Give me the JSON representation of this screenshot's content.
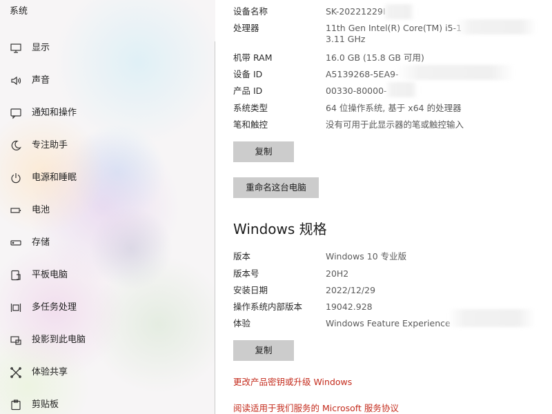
{
  "sidebar": {
    "title": "系统",
    "items": [
      {
        "label": "显示",
        "icon": "monitor-icon"
      },
      {
        "label": "声音",
        "icon": "speaker-icon"
      },
      {
        "label": "通知和操作",
        "icon": "notification-icon"
      },
      {
        "label": "专注助手",
        "icon": "moon-icon"
      },
      {
        "label": "电源和睡眠",
        "icon": "power-icon"
      },
      {
        "label": "电池",
        "icon": "battery-icon"
      },
      {
        "label": "存储",
        "icon": "storage-icon"
      },
      {
        "label": "平板电脑",
        "icon": "tablet-icon"
      },
      {
        "label": "多任务处理",
        "icon": "multitasking-icon"
      },
      {
        "label": "投影到此电脑",
        "icon": "project-icon"
      },
      {
        "label": "体验共享",
        "icon": "shared-experience-icon"
      },
      {
        "label": "剪贴板",
        "icon": "clipboard-icon"
      }
    ]
  },
  "device_specs": {
    "rows": [
      {
        "label": "设备名称",
        "value": "SK-20221229I"
      },
      {
        "label": "处理器",
        "value": "11th Gen Intel(R) Core(TM) i5-1",
        "value2": "3.11 GHz"
      },
      {
        "label": "机带 RAM",
        "value": "16.0 GB (15.8 GB 可用)"
      },
      {
        "label": "设备 ID",
        "value": "A5139268-5EA9-"
      },
      {
        "label": "产品 ID",
        "value": "00330-80000-"
      },
      {
        "label": "系统类型",
        "value": "64 位操作系统, 基于 x64 的处理器"
      },
      {
        "label": "笔和触控",
        "value": "没有可用于此显示器的笔或触控输入"
      }
    ],
    "copy_button": "复制",
    "rename_button": "重命名这台电脑"
  },
  "windows_specs": {
    "title": "Windows 规格",
    "rows": [
      {
        "label": "版本",
        "value": "Windows 10 专业版"
      },
      {
        "label": "版本号",
        "value": "20H2"
      },
      {
        "label": "安装日期",
        "value": "2022/12/29"
      },
      {
        "label": "操作系统内部版本",
        "value": "19042.928"
      },
      {
        "label": "体验",
        "value": "Windows Feature Experience"
      }
    ],
    "copy_button": "复制"
  },
  "links": {
    "change_key": "更改产品密钥或升级 Windows",
    "read_agreement": "阅读适用于我们服务的 Microsoft 服务协议"
  },
  "colors": {
    "link": "#c42b1c",
    "button_bg": "#cccccc"
  }
}
